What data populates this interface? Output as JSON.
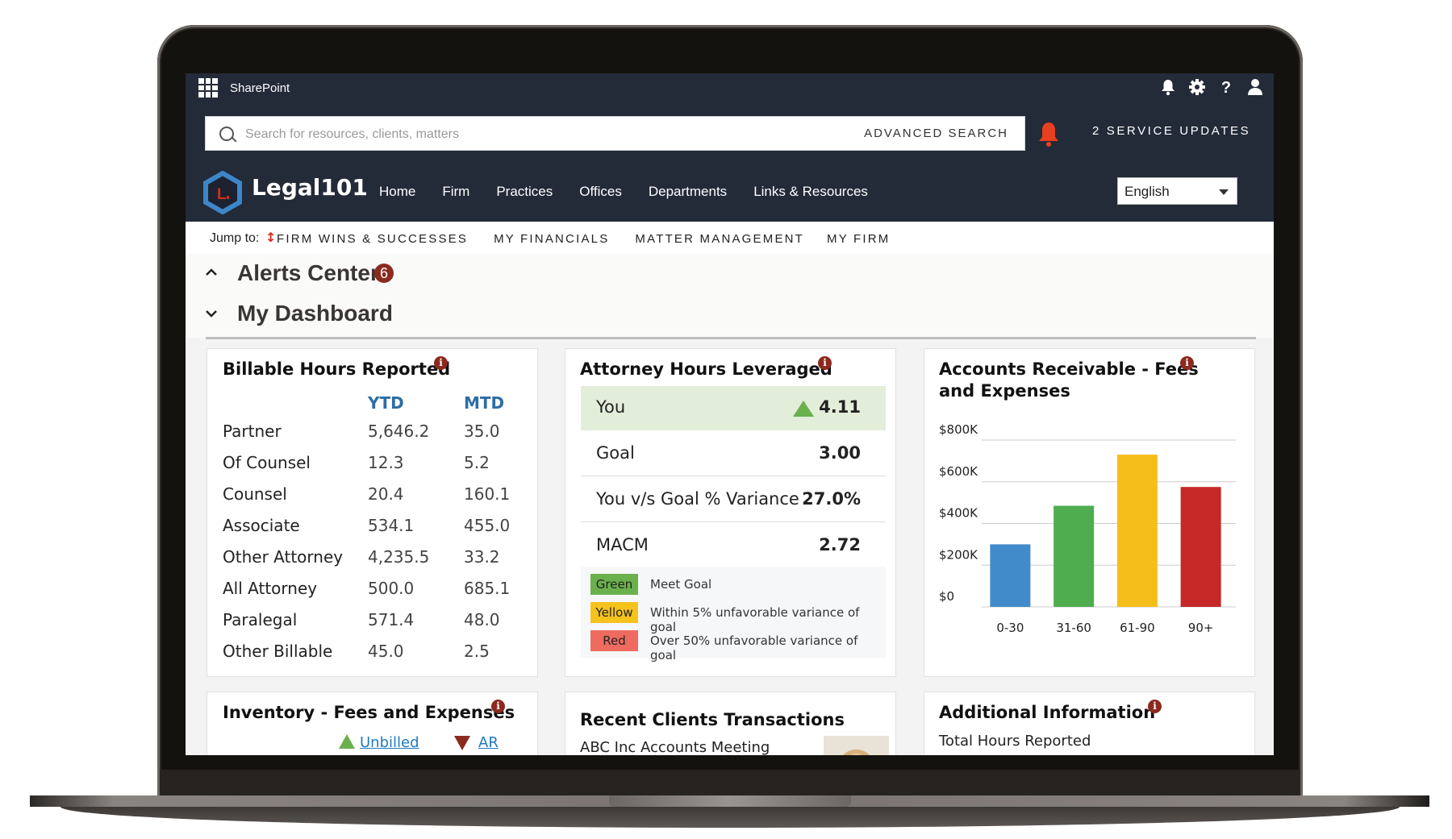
{
  "app": {
    "suite_title": "SharePoint",
    "brand": "Legal101"
  },
  "top_icons": [
    {
      "name": "bell-icon",
      "glyph": "🔔"
    },
    {
      "name": "gear-icon",
      "glyph": "⚙"
    },
    {
      "name": "help-icon",
      "glyph": "?"
    },
    {
      "name": "user-icon",
      "glyph": "👤"
    }
  ],
  "search": {
    "placeholder": "Search for resources, clients, matters",
    "value": "",
    "advanced_label": "ADVANCED SEARCH"
  },
  "service_updates": "2 SERVICE UPDATES",
  "nav": [
    "Home",
    "Firm",
    "Practices",
    "Offices",
    "Departments",
    "Links & Resources"
  ],
  "language": {
    "selected": "English"
  },
  "jump_to": {
    "label": "Jump to:",
    "links": [
      "FIRM WINS & SUCCESSES",
      "MY FINANCIALS",
      "MATTER MANAGEMENT",
      "MY FIRM"
    ]
  },
  "sections": {
    "alerts": {
      "title": "Alerts Center",
      "count": "6"
    },
    "dashboard": {
      "title": "My Dashboard"
    }
  },
  "billable_hours": {
    "title": "Billable Hours Reported",
    "columns": [
      "YTD",
      "MTD"
    ],
    "rows": [
      {
        "label": "Partner",
        "ytd": "5,646.2",
        "mtd": "35.0"
      },
      {
        "label": "Of Counsel",
        "ytd": "12.3",
        "mtd": "5.2"
      },
      {
        "label": "Counsel",
        "ytd": "20.4",
        "mtd": "160.1"
      },
      {
        "label": "Associate",
        "ytd": "534.1",
        "mtd": "455.0"
      },
      {
        "label": "Other Attorney",
        "ytd": "4,235.5",
        "mtd": "33.2"
      },
      {
        "label": "All Attorney",
        "ytd": "500.0",
        "mtd": "685.1"
      },
      {
        "label": "Paralegal",
        "ytd": "571.4",
        "mtd": "48.0"
      },
      {
        "label": "Other Billable",
        "ytd": "45.0",
        "mtd": "2.5"
      }
    ]
  },
  "attorney_hours": {
    "title": "Attorney Hours Leveraged",
    "rows": [
      {
        "label": "You",
        "value": "4.11",
        "trend": "up"
      },
      {
        "label": "Goal",
        "value": "3.00"
      },
      {
        "label": "You v/s Goal % Variance",
        "value": "27.0%"
      },
      {
        "label": "MACM",
        "value": "2.72"
      }
    ],
    "legend": [
      {
        "swatch": "Green",
        "color": "#6ab04c",
        "text": "Meet Goal"
      },
      {
        "swatch": "Yellow",
        "color": "#f6c21c",
        "text": "Within 5% unfavorable variance of goal"
      },
      {
        "swatch": "Red",
        "color": "#ef6b5f",
        "text": "Over 50% unfavorable variance of goal"
      }
    ]
  },
  "accounts_receivable": {
    "title_line1": "Accounts Receivable - Fees",
    "title_line2": "and Expenses"
  },
  "chart_data": {
    "type": "bar",
    "title": "Accounts Receivable - Fees and Expenses",
    "xlabel": "",
    "ylabel": "",
    "categories": [
      "0-30",
      "31-60",
      "61-90",
      "90+"
    ],
    "values": [
      300000,
      485000,
      730000,
      575000
    ],
    "colors": [
      "#428bca",
      "#4fad50",
      "#f6be1a",
      "#c62828"
    ],
    "ylim": [
      0,
      800000
    ],
    "yticks": [
      0,
      200000,
      400000,
      600000,
      800000
    ],
    "ytick_labels": [
      "$0",
      "$200K",
      "$400K",
      "$600K",
      "$800K"
    ],
    "grid": true,
    "legend": "none"
  },
  "inventory": {
    "title": "Inventory - Fees and Expenses",
    "links": [
      {
        "label": "Unbilled",
        "trend": "up"
      },
      {
        "label": "AR",
        "trend": "down"
      }
    ]
  },
  "recent_clients": {
    "title": "Recent Clients Transactions",
    "items": [
      "ABC Inc Accounts Meeting"
    ]
  },
  "additional_info": {
    "title": "Additional Information",
    "items": [
      "Total Hours Reported"
    ]
  }
}
